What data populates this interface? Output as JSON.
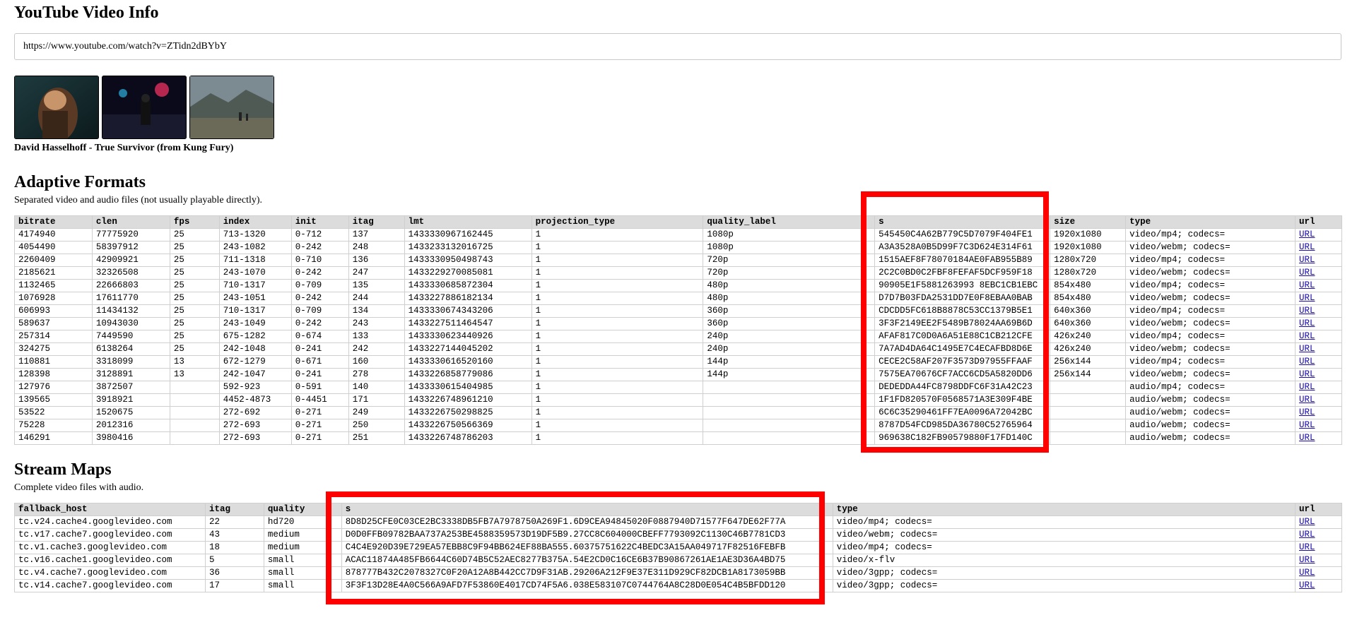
{
  "page_title": "YouTube Video Info",
  "url_input": {
    "value": "https://www.youtube.com/watch?v=ZTidn2dBYbY"
  },
  "video_title": "David Hasselhoff - True Survivor (from Kung Fury)",
  "adaptive": {
    "heading": "Adaptive Formats",
    "description": "Separated video and audio files (not usually playable directly).",
    "columns": [
      "bitrate",
      "clen",
      "fps",
      "index",
      "init",
      "itag",
      "lmt",
      "projection_type",
      "quality_label",
      "s",
      "size",
      "type",
      "url"
    ],
    "rows": [
      [
        "4174940",
        "77775920",
        "25",
        "713-1320",
        "0-712",
        "137",
        "1433330967162445",
        "1",
        "1080p",
        "545450C4A62B779C5D7079F404FE1",
        "1920x1080",
        "video/mp4; codecs=",
        "URL"
      ],
      [
        "4054490",
        "58397912",
        "25",
        "243-1082",
        "0-242",
        "248",
        "1433233132016725",
        "1",
        "1080p",
        "A3A3528A0B5D99F7C3D624E314F61",
        "1920x1080",
        "video/webm; codecs=",
        "URL"
      ],
      [
        "2260409",
        "42909921",
        "25",
        "711-1318",
        "0-710",
        "136",
        "1433330950498743",
        "1",
        "720p",
        "1515AEF8F78070184AE0FAB955B89",
        "1280x720",
        "video/mp4; codecs=",
        "URL"
      ],
      [
        "2185621",
        "32326508",
        "25",
        "243-1070",
        "0-242",
        "247",
        "1433229270085081",
        "1",
        "720p",
        "2C2C0BD0C2FBF8FEFAF5DCF959F18",
        "1280x720",
        "video/webm; codecs=",
        "URL"
      ],
      [
        "1132465",
        "22666803",
        "25",
        "710-1317",
        "0-709",
        "135",
        "1433330685872304",
        "1",
        "480p",
        "90905E1F5881263993 8EBC1CB1EBC",
        "854x480",
        "video/mp4; codecs=",
        "URL"
      ],
      [
        "1076928",
        "17611770",
        "25",
        "243-1051",
        "0-242",
        "244",
        "1433227886182134",
        "1",
        "480p",
        "D7D7B03FDA2531DD7E0F8EBAA0BAB",
        "854x480",
        "video/webm; codecs=",
        "URL"
      ],
      [
        "606993",
        "11434132",
        "25",
        "710-1317",
        "0-709",
        "134",
        "1433330674343206",
        "1",
        "360p",
        "CDCDD5FC618B8878C53CC1379B5E1",
        "640x360",
        "video/mp4; codecs=",
        "URL"
      ],
      [
        "589637",
        "10943030",
        "25",
        "243-1049",
        "0-242",
        "243",
        "1433227511464547",
        "1",
        "360p",
        "3F3F2149EE2F5489B78024AA69B6D",
        "640x360",
        "video/webm; codecs=",
        "URL"
      ],
      [
        "257314",
        "7449590",
        "25",
        "675-1282",
        "0-674",
        "133",
        "1433330623440926",
        "1",
        "240p",
        "AFAF817C0D0A6A51E88C1CB212CFE",
        "426x240",
        "video/mp4; codecs=",
        "URL"
      ],
      [
        "324275",
        "6138264",
        "25",
        "242-1048",
        "0-241",
        "242",
        "1433227144045202",
        "1",
        "240p",
        "7A7AD4DA64C1495E7C4ECAFBD8D6E",
        "426x240",
        "video/webm; codecs=",
        "URL"
      ],
      [
        "110881",
        "3318099",
        "13",
        "672-1279",
        "0-671",
        "160",
        "1433330616520160",
        "1",
        "144p",
        "CECE2C58AF207F3573D97955FFAAF",
        "256x144",
        "video/mp4; codecs=",
        "URL"
      ],
      [
        "128398",
        "3128891",
        "13",
        "242-1047",
        "0-241",
        "278",
        "1433226858779086",
        "1",
        "144p",
        "7575EA70676CF7ACC6CD5A5820DD6",
        "256x144",
        "video/webm; codecs=",
        "URL"
      ],
      [
        "127976",
        "3872507",
        "",
        "592-923",
        "0-591",
        "140",
        "1433330615404985",
        "1",
        "",
        "DEDEDDA44FC8798DDFC6F31A42C23",
        "",
        "audio/mp4; codecs=",
        "URL"
      ],
      [
        "139565",
        "3918921",
        "",
        "4452-4873",
        "0-4451",
        "171",
        "1433226748961210",
        "1",
        "",
        "1F1FD820570F0568571A3E309F4BE",
        "",
        "audio/webm; codecs=",
        "URL"
      ],
      [
        "53522",
        "1520675",
        "",
        "272-692",
        "0-271",
        "249",
        "1433226750298825",
        "1",
        "",
        "6C6C35290461FF7EA0096A72042BC",
        "",
        "audio/webm; codecs=",
        "URL"
      ],
      [
        "75228",
        "2012316",
        "",
        "272-693",
        "0-271",
        "250",
        "1433226750566369",
        "1",
        "",
        "8787D54FCD985DA36780C52765964",
        "",
        "audio/webm; codecs=",
        "URL"
      ],
      [
        "146291",
        "3980416",
        "",
        "272-693",
        "0-271",
        "251",
        "1433226748786203",
        "1",
        "",
        "969638C182FB90579880F17FD140C",
        "",
        "audio/webm; codecs=",
        "URL"
      ]
    ]
  },
  "stream": {
    "heading": "Stream Maps",
    "description": "Complete video files with audio.",
    "columns": [
      "fallback_host",
      "itag",
      "quality",
      "s",
      "type",
      "url"
    ],
    "rows": [
      [
        "tc.v24.cache4.googlevideo.com",
        "22",
        "hd720",
        "8D8D25CFE0C03CE2BC3338DB5FB7A7978750A269F1.6D9CEA94845020F0887940D71577F647DE62F77A",
        "video/mp4; codecs=",
        "URL"
      ],
      [
        "tc.v17.cache7.googlevideo.com",
        "43",
        "medium",
        "D0D0FFB09782BAA737A253BE4588359573D19DF5B9.27CC8C604000CBEFF7793092C1130C46B7781CD3",
        "video/webm; codecs=",
        "URL"
      ],
      [
        "tc.v1.cache3.googlevideo.com",
        "18",
        "medium",
        "C4C4E920D39E729EA57EBB8C9F94BB624EF88BA555.60375751622C4BEDC3A15AA049717F82516FEBFB",
        "video/mp4; codecs=",
        "URL"
      ],
      [
        "tc.v16.cache1.googlevideo.com",
        "5",
        "small",
        "ACAC11874A485FB6644C60D74B5C52AEC8277B375A.54E2CD0C16CE6B37B90867261AE1AE3D36A4BD75",
        "video/x-flv",
        "URL"
      ],
      [
        "tc.v4.cache7.googlevideo.com",
        "36",
        "small",
        "878777B432C2078327C0F20A12A8B442CC7D9F31AB.29206A212F9E37E311D929CF82DCB1A8173059BB",
        "video/3gpp; codecs=",
        "URL"
      ],
      [
        "tc.v14.cache7.googlevideo.com",
        "17",
        "small",
        "3F3F13D28E4A0C566A9AFD7F53860E4017CD74F5A6.038E583107C0744764A8C28D0E054C4B5BFDD120",
        "video/3gpp; codecs=",
        "URL"
      ]
    ]
  },
  "colors": {
    "highlight": "#ff0000",
    "header_bg": "#dcdcdc",
    "link": "#1a0dab"
  }
}
